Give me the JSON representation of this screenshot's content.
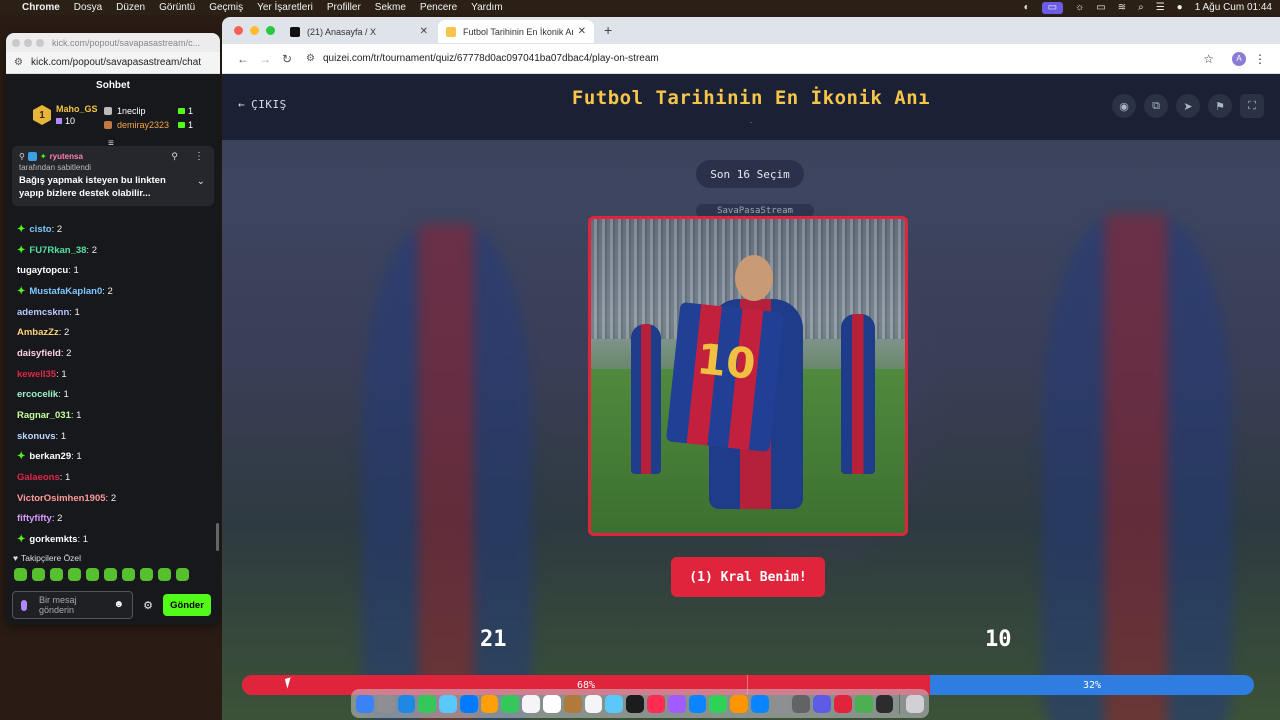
{
  "menubar": {
    "apple": "",
    "items": [
      "Chrome",
      "Dosya",
      "Düzen",
      "Görüntü",
      "Geçmiş",
      "Yer İşaretleri",
      "Profiller",
      "Sekme",
      "Pencere",
      "Yardım"
    ],
    "datetime": "1 Ağu Cum  01:44"
  },
  "chat_window": {
    "title_url": "kick.com/popout/savapasastream/c...",
    "address": "kick.com/popout/savapasastream/chat",
    "header": "Sohbet",
    "leaders": {
      "first": {
        "rank": "1",
        "name": "Maho_GS",
        "count": "10"
      },
      "others": [
        {
          "name": "1neclip",
          "count": "1"
        },
        {
          "name": "demiray2323",
          "count": "1"
        }
      ]
    },
    "pinned": {
      "user": "ryutensa",
      "pinned_by": "tarafından sabitlendi",
      "message": "Bağış yapmak isteyen bu linkten yapıp bizlere destek olabilir..."
    },
    "messages": [
      {
        "user": "cisto",
        "text": ": 2",
        "color": "#7ec8ff",
        "sparkle": true
      },
      {
        "user": "FU7Rkan_38",
        "text": ": 2",
        "color": "#53e0a0",
        "sparkle": true
      },
      {
        "user": "tugaytopcu",
        "text": ": 1",
        "color": "#ffffff",
        "sparkle": false
      },
      {
        "user": "MustafaKaplan0",
        "text": ": 2",
        "color": "#7ec8ff",
        "sparkle": true
      },
      {
        "user": "ademcsknn",
        "text": ": 1",
        "color": "#b9c8ff",
        "sparkle": false
      },
      {
        "user": "AmbazZz",
        "text": ": 2",
        "color": "#ffd27a",
        "sparkle": false
      },
      {
        "user": "daisyfield",
        "text": ": 2",
        "color": "#ffd1e0",
        "sparkle": false
      },
      {
        "user": "kewell35",
        "text": ": 1",
        "color": "#e0264a",
        "sparkle": false
      },
      {
        "user": "ercocelik",
        "text": ": 1",
        "color": "#9ff0c8",
        "sparkle": false
      },
      {
        "user": "Ragnar_031",
        "text": ": 1",
        "color": "#c6ff9a",
        "sparkle": false
      },
      {
        "user": "skonuvs",
        "text": ": 1",
        "color": "#b9d8ff",
        "sparkle": false
      },
      {
        "user": "berkan29",
        "text": ": 1",
        "color": "#ffffff",
        "sparkle": true
      },
      {
        "user": "Galaeons",
        "text": ": 1",
        "color": "#e0264a",
        "sparkle": false
      },
      {
        "user": "VictorOsimhen1905",
        "text": ": 2",
        "color": "#ff9a9a",
        "sparkle": false
      },
      {
        "user": "fiftyfifty",
        "text": ": 2",
        "color": "#d79aff",
        "sparkle": false
      },
      {
        "user": "gorkemkts",
        "text": ": 1",
        "color": "#ffffff",
        "sparkle": true
      }
    ],
    "emote_label": "Takipçilere Özel",
    "input_placeholder": "Bir mesaj gönderin",
    "send_label": "Gönder"
  },
  "browser": {
    "tabs": [
      {
        "title": "(21) Anasayfa / X",
        "active": false
      },
      {
        "title": "Futbol Tarihinin En İkonik Anı",
        "active": true
      }
    ],
    "url": "quizei.com/tr/tournament/quiz/67778d0ac097041ba07dbac4/play-on-stream",
    "profile_initial": "A"
  },
  "quiz": {
    "exit_label": "ÇIKIŞ",
    "title": "Futbol Tarihinin En İkonik Anı",
    "subtitle": ".",
    "round": "Son 16 Seçim",
    "ghost_text": "SavaPasaStream",
    "shirt_number": "10",
    "vote_button": "(1) Kral Benim!",
    "score_left": "21",
    "score_right": "10",
    "left_percent_label": "68%",
    "right_percent_label": "32%",
    "left_fraction": 0.68,
    "accent_red": "#e0243c",
    "accent_blue": "#2f7de1",
    "title_color": "#f6c54a"
  }
}
